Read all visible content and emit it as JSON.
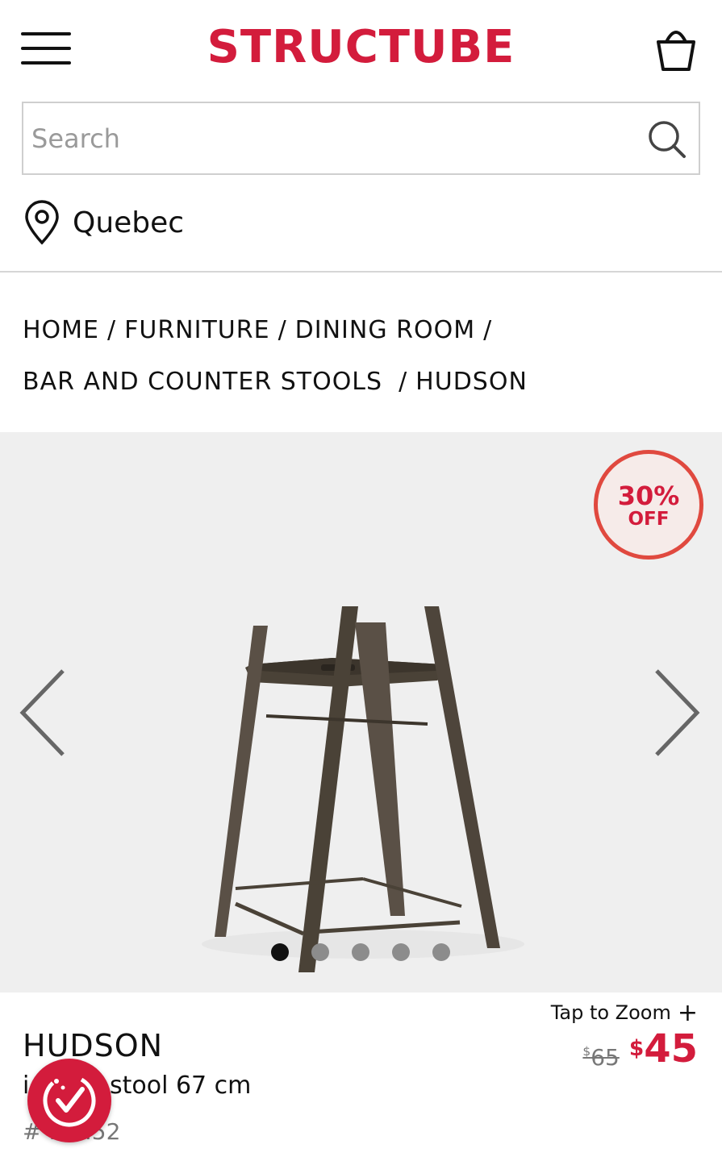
{
  "header": {
    "logo": "STRUCTUBE"
  },
  "search": {
    "placeholder": "Search"
  },
  "location": {
    "label": "Quebec"
  },
  "breadcrumb": {
    "items": [
      "HOME",
      "FURNITURE",
      "DINING ROOM",
      "BAR AND COUNTER STOOLS",
      "HUDSON"
    ],
    "separator": "/"
  },
  "gallery": {
    "discount": {
      "percent": "30%",
      "label": "OFF"
    },
    "image_count": 5,
    "active_index": 0
  },
  "product": {
    "zoom_label": "Tap to Zoom",
    "name": "HUDSON",
    "subtitle": "i unter stool 67 cm",
    "sku": "# .15.52",
    "old_price_currency": "$",
    "old_price": "65",
    "new_price_currency": "$",
    "new_price": "45"
  },
  "colors": {
    "brand": "#d31c3c",
    "badge_border": "#e0493f",
    "gallery_bg": "#efefef"
  },
  "icons": {
    "menu": "hamburger-icon",
    "cart": "shopping-basket-icon",
    "search": "search-icon",
    "location": "map-pin-icon",
    "prev": "chevron-left-icon",
    "next": "chevron-right-icon",
    "reviews": "review-check-icon"
  }
}
